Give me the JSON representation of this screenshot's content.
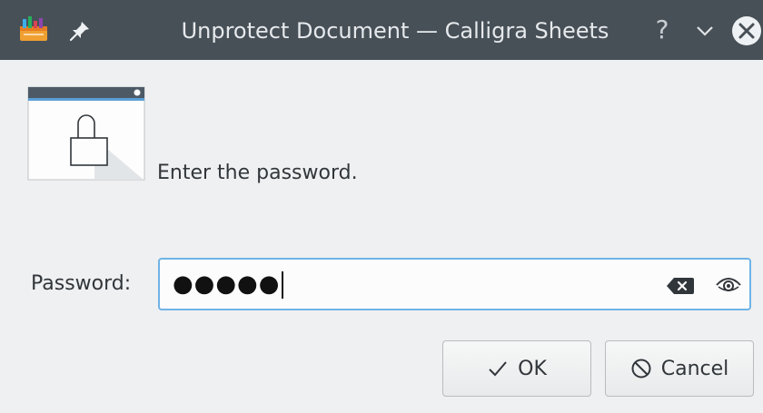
{
  "window": {
    "title": "Unprotect Document — Calligra Sheets",
    "help_label": "?"
  },
  "icons": {
    "app": "calligra-sheets-icon",
    "pin": "pin-icon",
    "minimize": "chevron-down-icon",
    "close": "close-icon",
    "lock": "lock-icon",
    "clear": "backspace-clear-icon",
    "reveal": "eye-icon",
    "ok": "checkmark-icon",
    "cancel": "cancel-circle-icon"
  },
  "dialog": {
    "message": "Enter the password.",
    "password_label": "Password:",
    "password_masked": "●●●●●"
  },
  "buttons": {
    "ok": "OK",
    "cancel": "Cancel"
  },
  "colors": {
    "titlebar": "#475057",
    "background": "#eff0f1",
    "focus_border": "#6fb3e6"
  }
}
